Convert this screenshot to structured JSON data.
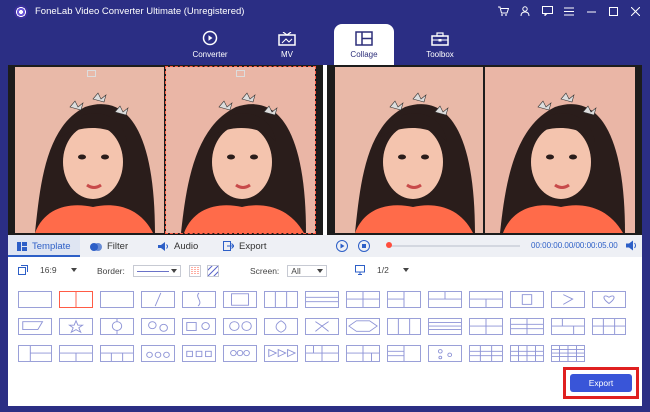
{
  "app": {
    "title": "FoneLab Video Converter Ultimate (Unregistered)"
  },
  "window_icons": [
    "cart-icon",
    "user-icon",
    "feedback-icon",
    "menu-icon",
    "minimize-icon",
    "maximize-icon",
    "close-icon"
  ],
  "nav": {
    "tabs": [
      {
        "label": "Converter",
        "icon": "converter-icon",
        "active": false
      },
      {
        "label": "MV",
        "icon": "tv-icon",
        "active": false
      },
      {
        "label": "Collage",
        "icon": "collage-icon",
        "active": true
      },
      {
        "label": "Toolbox",
        "icon": "toolbox-icon",
        "active": false
      }
    ]
  },
  "edit_tabs": [
    {
      "label": "Template",
      "icon": "template-icon",
      "active": true
    },
    {
      "label": "Filter",
      "icon": "filter-icon",
      "active": false
    },
    {
      "label": "Audio",
      "icon": "audio-icon",
      "active": false
    },
    {
      "label": "Export",
      "icon": "export-icon",
      "active": false
    }
  ],
  "player": {
    "time": "00:00:00.00/00:00:05.00",
    "progress": 0.0
  },
  "settings": {
    "ratio": "16:9",
    "border_label": "Border:",
    "screen_label": "Screen:",
    "screen_value": "All",
    "page": "1/2"
  },
  "templates_selected_index": 1,
  "export_label": "Export",
  "colors": {
    "brand": "#2b2e84",
    "accent": "#3955d8",
    "highlight": "#e02020",
    "selection": "#ff5b45"
  }
}
